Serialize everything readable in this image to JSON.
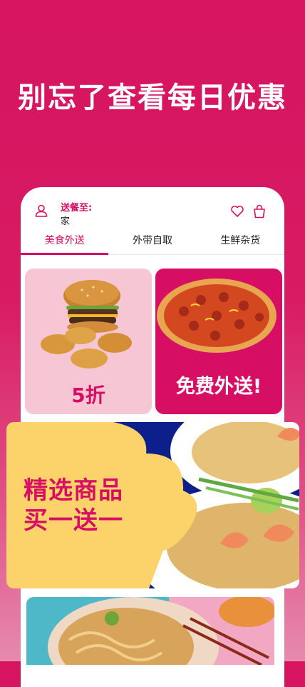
{
  "headline": "别忘了查看每日优惠",
  "header": {
    "delivery_label": "送餐至:",
    "delivery_address": "家"
  },
  "tabs": [
    {
      "label": "美食外送",
      "active": true
    },
    {
      "label": "外带自取",
      "active": false
    },
    {
      "label": "生鲜杂货",
      "active": false
    }
  ],
  "cards": {
    "left_label": "5折",
    "right_label": "免费外送!"
  },
  "promo": {
    "line1": "精选商品",
    "line2": "买一送一"
  },
  "colors": {
    "brand_pink": "#d70f64",
    "promo_yellow": "#fcd36b",
    "promo_navy": "#0c1f8a"
  }
}
